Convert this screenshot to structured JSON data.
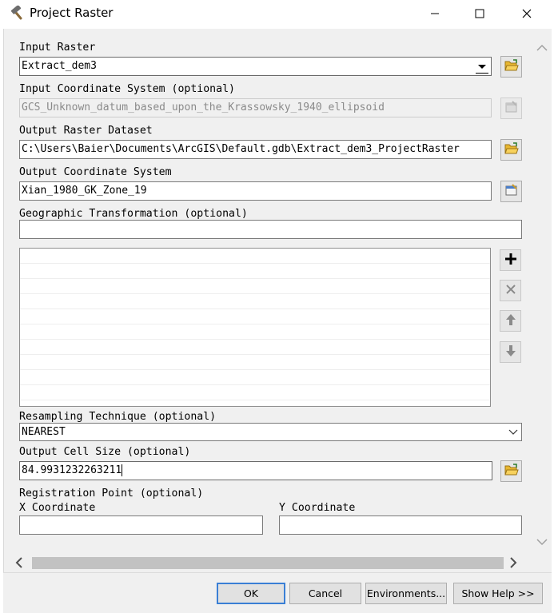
{
  "window": {
    "title": "Project Raster",
    "icons": {
      "app": "hammer-icon",
      "minimize": "minimize-icon",
      "maximize": "maximize-icon",
      "close": "close-icon"
    }
  },
  "form": {
    "input_raster": {
      "label": "Input Raster",
      "value": "Extract_dem3"
    },
    "input_coord": {
      "label": "Input Coordinate System (optional)",
      "value": "GCS_Unknown_datum_based_upon_the_Krassowsky_1940_ellipsoid"
    },
    "output_raster": {
      "label": "Output Raster Dataset",
      "value": "C:\\Users\\Baier\\Documents\\ArcGIS\\Default.gdb\\Extract_dem3_ProjectRaster"
    },
    "output_coord": {
      "label": "Output Coordinate System",
      "value": "Xian_1980_GK_Zone_19"
    },
    "geo_transform": {
      "label": "Geographic Transformation (optional)",
      "value": ""
    },
    "resampling": {
      "label": "Resampling Technique (optional)",
      "value": "NEAREST"
    },
    "cell_size": {
      "label": "Output Cell Size (optional)",
      "value": "84.9931232263211"
    },
    "registration": {
      "label": "Registration Point (optional)",
      "x_label": "X Coordinate",
      "x_value": "",
      "y_label": "Y Coordinate",
      "y_value": ""
    }
  },
  "buttons": {
    "ok": "OK",
    "cancel": "Cancel",
    "environments": "Environments...",
    "show_help": "Show Help >>"
  },
  "colors": {
    "default_button_border": "#3a7fd5",
    "panel_bg": "#f0f0f0"
  }
}
